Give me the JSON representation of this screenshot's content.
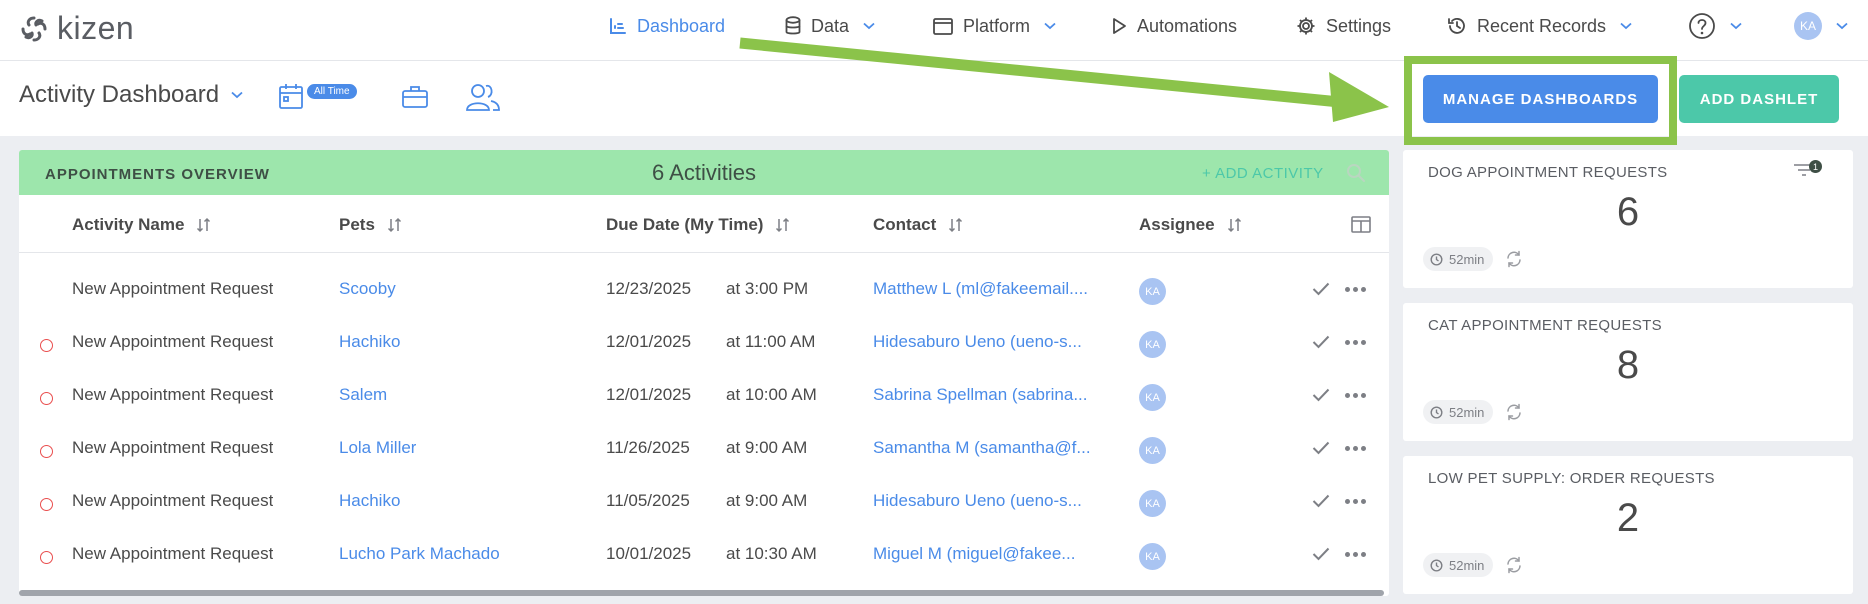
{
  "app": {
    "brand": "kizen"
  },
  "nav": {
    "items": [
      {
        "label": "Dashboard",
        "icon": "chart-bar-icon",
        "active": true
      },
      {
        "label": "Data",
        "icon": "database-icon",
        "dropdown": true
      },
      {
        "label": "Platform",
        "icon": "window-icon",
        "dropdown": true
      },
      {
        "label": "Automations",
        "icon": "play-icon"
      },
      {
        "label": "Settings",
        "icon": "gear-icon"
      },
      {
        "label": "Recent Records",
        "icon": "history-icon",
        "dropdown": true
      }
    ],
    "help_icon": "question-circle-icon",
    "user_initials": "KA"
  },
  "subheader": {
    "title": "Activity Dashboard",
    "date_badge": "All Time",
    "manage_button": "MANAGE DASHBOARDS",
    "add_dashlet_button": "ADD DASHLET"
  },
  "appointments": {
    "title": "APPOINTMENTS OVERVIEW",
    "count_label": "6 Activities",
    "add_activity_label": "+ ADD ACTIVITY",
    "columns": [
      "Activity Name",
      "Pets",
      "Due Date (My Time)",
      "Contact",
      "Assignee"
    ],
    "rows": [
      {
        "name": "New Appointment Request",
        "pet": "Scooby",
        "date": "12/23/2025",
        "time": "at 3:00 PM",
        "contact": "Matthew L (ml@fakeemail....",
        "assignee": "KA",
        "overdue": false
      },
      {
        "name": "New Appointment Request",
        "pet": "Hachiko",
        "date": "12/01/2025",
        "time": "at 11:00 AM",
        "contact": "Hidesaburo Ueno (ueno-s...",
        "assignee": "KA",
        "overdue": true
      },
      {
        "name": "New Appointment Request",
        "pet": "Salem",
        "date": "12/01/2025",
        "time": "at 10:00 AM",
        "contact": "Sabrina Spellman (sabrina...",
        "assignee": "KA",
        "overdue": true
      },
      {
        "name": "New Appointment Request",
        "pet": "Lola Miller",
        "date": "11/26/2025",
        "time": "at 9:00 AM",
        "contact": "Samantha M (samantha@f...",
        "assignee": "KA",
        "overdue": true
      },
      {
        "name": "New Appointment Request",
        "pet": "Hachiko",
        "date": "11/05/2025",
        "time": "at 9:00 AM",
        "contact": "Hidesaburo Ueno (ueno-s...",
        "assignee": "KA",
        "overdue": true
      },
      {
        "name": "New Appointment Request",
        "pet": "Lucho Park Machado",
        "date": "10/01/2025",
        "time": "at 10:30 AM",
        "contact": "Miguel M (miguel@fakee...",
        "assignee": "KA",
        "overdue": true
      }
    ]
  },
  "dashlets": [
    {
      "title": "DOG APPOINTMENT REQUESTS",
      "value": "6",
      "age": "52min",
      "filter_count": "1"
    },
    {
      "title": "CAT APPOINTMENT REQUESTS",
      "value": "8",
      "age": "52min"
    },
    {
      "title": "LOW PET SUPPLY: ORDER REQUESTS",
      "value": "2",
      "age": "52min"
    }
  ],
  "colors": {
    "accent": "#4a8be8",
    "teal": "#4cc8a9",
    "header_green": "#9de6ac",
    "highlight_green": "#8bc34a",
    "overdue_red": "#e94e4e"
  }
}
